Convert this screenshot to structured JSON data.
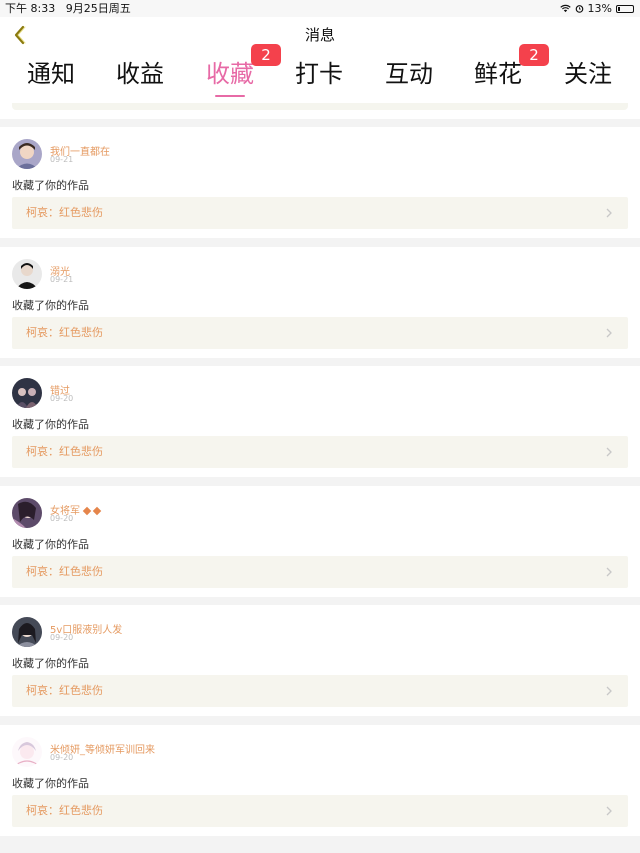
{
  "statusbar": {
    "time": "下午 8:33",
    "date": "9月25日周五",
    "battery": "13%"
  },
  "navbar": {
    "title": "消息"
  },
  "tabs": [
    {
      "label": "通知"
    },
    {
      "label": "收益"
    },
    {
      "label": "收藏",
      "badge": "2",
      "active": true
    },
    {
      "label": "打卡"
    },
    {
      "label": "互动"
    },
    {
      "label": "鲜花",
      "badge": "2"
    },
    {
      "label": "关注"
    }
  ],
  "action_text": "收藏了你的作品",
  "items": [
    {
      "name": "我们一直都在",
      "date": "09-21",
      "action": "收藏了你的作品",
      "work": "柯哀：红色悲伤"
    },
    {
      "name": "溺光",
      "date": "09-21",
      "action": "收藏了你的作品",
      "work": "柯哀：红色悲伤"
    },
    {
      "name": "错过",
      "date": "09-20",
      "action": "收藏了你的作品",
      "work": "柯哀：红色悲伤"
    },
    {
      "name": "女将军",
      "date": "09-20",
      "action": "收藏了你的作品",
      "work": "柯哀：红色悲伤"
    },
    {
      "name": "5v口服液别人发",
      "date": "09-20",
      "action": "收藏了你的作品",
      "work": "柯哀：红色悲伤"
    },
    {
      "name": "米倾妍_等倾妍军训回来",
      "date": "09-20",
      "action": "收藏了你的作品",
      "work": "柯哀：红色悲伤"
    }
  ],
  "colors": {
    "accent": "#e76aa6",
    "badge": "#f4414c",
    "name": "#e59a61",
    "work_bg": "#f6f5ee"
  }
}
